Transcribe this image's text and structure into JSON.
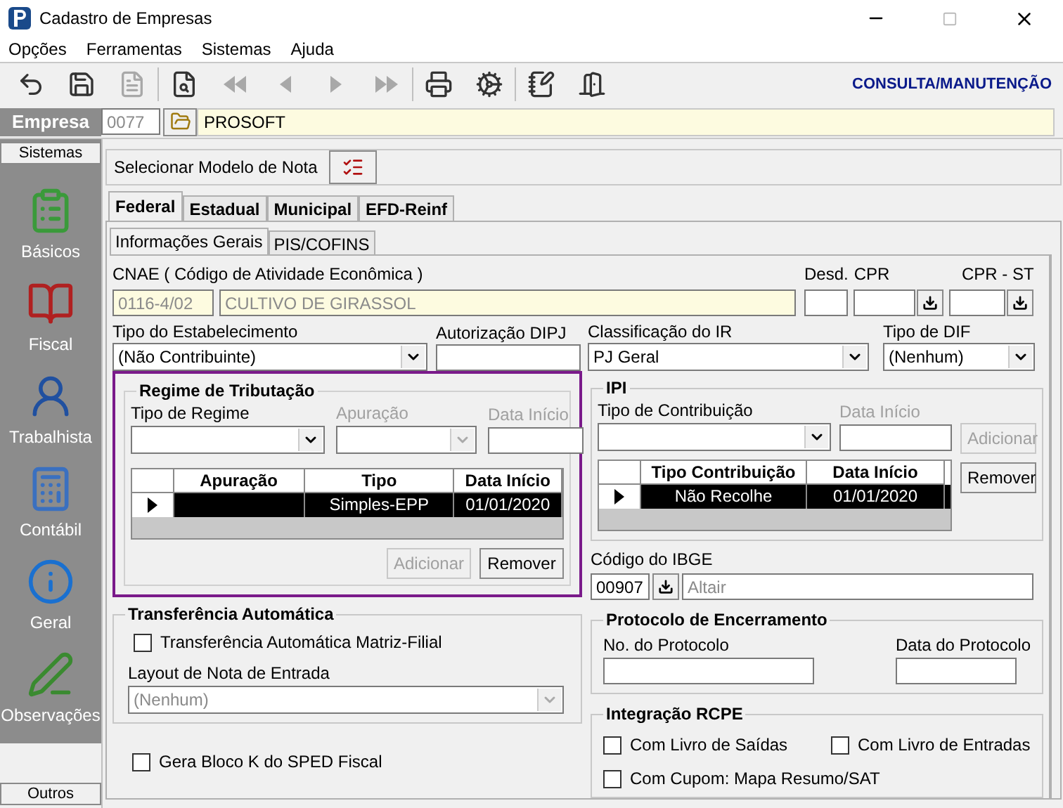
{
  "window": {
    "title": "Cadastro de Empresas"
  },
  "menu": [
    "Opções",
    "Ferramentas",
    "Sistemas",
    "Ajuda"
  ],
  "toolbar": {
    "groups": [
      [
        {
          "kind": "undo",
          "disabled": false
        },
        {
          "kind": "save",
          "disabled": false
        },
        {
          "kind": "document",
          "disabled": true
        }
      ],
      [
        {
          "kind": "preview",
          "disabled": false
        },
        {
          "kind": "first",
          "disabled": true
        },
        {
          "kind": "prev",
          "disabled": true
        },
        {
          "kind": "next",
          "disabled": true
        },
        {
          "kind": "last",
          "disabled": true
        }
      ],
      [
        {
          "kind": "print",
          "disabled": false
        },
        {
          "kind": "tools",
          "disabled": false
        }
      ],
      [
        {
          "kind": "notes",
          "disabled": false
        },
        {
          "kind": "exit",
          "disabled": false
        }
      ]
    ],
    "mode": "CONSULTA/MANUTENÇÃO"
  },
  "empresa": {
    "label": "Empresa",
    "code": "0077",
    "name": "PROSOFT"
  },
  "sidebar": {
    "header": "Sistemas",
    "items": [
      {
        "label": "Básicos",
        "kind": "forms"
      },
      {
        "label": "Fiscal",
        "kind": "book"
      },
      {
        "label": "Trabalhista",
        "kind": "person"
      },
      {
        "label": "Contábil",
        "kind": "calculator"
      },
      {
        "label": "Geral",
        "kind": "info"
      },
      {
        "label": "Observações",
        "kind": "pen"
      }
    ],
    "footer": "Outros"
  },
  "modelo_nota": {
    "label": "Selecionar Modelo de Nota"
  },
  "tabs": [
    {
      "label": "Federal",
      "selected": true
    },
    {
      "label": "Estadual",
      "selected": false
    },
    {
      "label": "Municipal",
      "selected": false
    },
    {
      "label": "EFD-Reinf",
      "selected": false
    }
  ],
  "subtabs": [
    {
      "label": "Informações Gerais",
      "selected": true
    },
    {
      "label": "PIS/COFINS",
      "selected": false
    }
  ],
  "cnae": {
    "label": "CNAE ( Código de  Atividade Econômica )",
    "code": "0116-4/02",
    "description": "CULTIVO DE GIRASSOL"
  },
  "desd": {
    "label": "Desd."
  },
  "cpr": {
    "label": "CPR"
  },
  "cpr_st": {
    "label": "CPR - ST"
  },
  "tipo_estabelecimento": {
    "label": "Tipo do Estabelecimento",
    "value": "(Não Contribuinte)"
  },
  "autorizacao_dipj": {
    "label": "Autorização DIPJ"
  },
  "classificacao_ir": {
    "label": "Classificação do IR",
    "value": "PJ Geral"
  },
  "tipo_dif": {
    "label": "Tipo de DIF",
    "value": "(Nenhum)"
  },
  "regime": {
    "title": "Regime de Tributação",
    "tipo": {
      "label": "Tipo de Regime"
    },
    "apuracao": {
      "label": "Apuração",
      "disabled": true
    },
    "data_inicio": {
      "label": "Data Início",
      "disabled": true
    },
    "table": {
      "columns": [
        "Apuração",
        "Tipo",
        "Data Início"
      ],
      "rows": [
        {
          "tipo": "Simples-EPP",
          "data_inicio": "01/01/2020",
          "selected": true
        }
      ]
    },
    "buttons": [
      {
        "label": "Adicionar",
        "disabled": true
      },
      {
        "label": "Remover",
        "disabled": false
      }
    ]
  },
  "ipi": {
    "title": "IPI",
    "tipo": {
      "label": "Tipo de Contribuição"
    },
    "data_inicio": {
      "label": "Data Início",
      "disabled": true
    },
    "table": {
      "columns": [
        "Tipo Contribuição",
        "Data Início"
      ],
      "rows": [
        {
          "tipo": "Não Recolhe",
          "data_inicio": "01/01/2020",
          "selected": true
        }
      ]
    },
    "buttons": [
      {
        "label": "Adicionar",
        "disabled": true
      },
      {
        "label": "Remover",
        "disabled": false
      }
    ]
  },
  "ibge": {
    "label": "Código do IBGE",
    "code": "00907",
    "city": "Altair"
  },
  "transferencia": {
    "title": "Transferência Automática",
    "checkbox": {
      "label": "Transferência Automática Matriz-Filial",
      "checked": false
    },
    "layout": {
      "label": "Layout de Nota de Entrada",
      "value": "(Nenhum)",
      "disabled": true
    }
  },
  "gera_bloco_k": {
    "label": "Gera Bloco K do SPED Fiscal",
    "checked": false
  },
  "protocolo": {
    "title": "Protocolo de Encerramento",
    "numero_label": "No. do Protocolo",
    "data_label": "Data do Protocolo"
  },
  "rcpe": {
    "title": "Integração RCPE",
    "options": [
      {
        "label": "Com Livro de Saídas",
        "checked": false
      },
      {
        "label": "Com Livro de Entradas",
        "checked": false
      },
      {
        "label": "Com Cupom: Mapa Resumo/SAT",
        "checked": false
      }
    ]
  }
}
